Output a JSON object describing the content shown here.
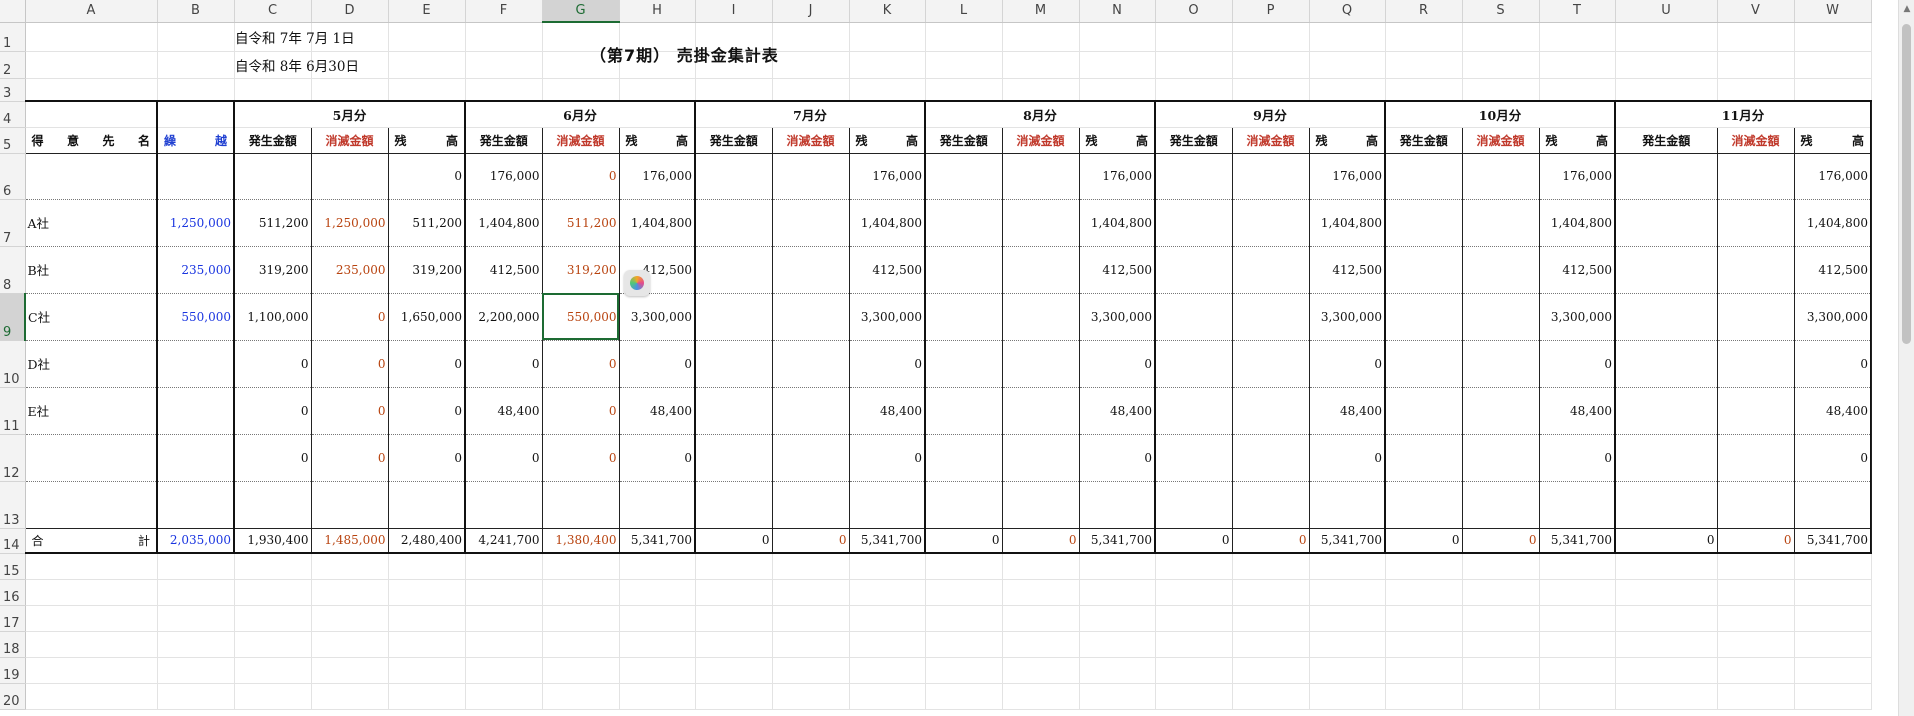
{
  "sheet": {
    "columns": [
      "A",
      "B",
      "C",
      "D",
      "E",
      "F",
      "G",
      "H",
      "I",
      "J",
      "K",
      "L",
      "M",
      "N",
      "O",
      "P",
      "Q",
      "R",
      "S",
      "T",
      "U",
      "V",
      "W"
    ],
    "selected_column": "G",
    "selected_row": 9,
    "row_numbers": [
      "1",
      "2",
      "3",
      "4",
      "5",
      "6",
      "7",
      "8",
      "9",
      "10",
      "11",
      "12",
      "13",
      "14",
      "15",
      "16",
      "17",
      "18",
      "19",
      "20"
    ]
  },
  "header": {
    "date_from": "自令和  7年  7月  1日",
    "date_to": "自令和  8年  6月30日",
    "title": "（第7期）  売掛金集計表"
  },
  "table": {
    "customer_header": "得意先名",
    "carryover_header": "繰越",
    "months": [
      "5月分",
      "6月分",
      "7月分",
      "8月分",
      "9月分",
      "10月分",
      "11月分"
    ],
    "sub_headers": {
      "hassei": "発生金額",
      "shometsu": "消滅金額",
      "zandaka": "残高"
    },
    "rows": [
      {
        "name": "",
        "carry": "",
        "months": [
          [
            "",
            "",
            "0"
          ],
          [
            "176,000",
            "0",
            "176,000"
          ],
          [
            "",
            "",
            "176,000"
          ],
          [
            "",
            "",
            "176,000"
          ],
          [
            "",
            "",
            "176,000"
          ],
          [
            "",
            "",
            "176,000"
          ],
          [
            "",
            "",
            "176,000"
          ]
        ]
      },
      {
        "name": "A社",
        "carry": "1,250,000",
        "months": [
          [
            "511,200",
            "1,250,000",
            "511,200"
          ],
          [
            "1,404,800",
            "511,200",
            "1,404,800"
          ],
          [
            "",
            "",
            "1,404,800"
          ],
          [
            "",
            "",
            "1,404,800"
          ],
          [
            "",
            "",
            "1,404,800"
          ],
          [
            "",
            "",
            "1,404,800"
          ],
          [
            "",
            "",
            "1,404,800"
          ]
        ]
      },
      {
        "name": "B社",
        "carry": "235,000",
        "months": [
          [
            "319,200",
            "235,000",
            "319,200"
          ],
          [
            "412,500",
            "319,200",
            "412,500"
          ],
          [
            "",
            "",
            "412,500"
          ],
          [
            "",
            "",
            "412,500"
          ],
          [
            "",
            "",
            "412,500"
          ],
          [
            "",
            "",
            "412,500"
          ],
          [
            "",
            "",
            "412,500"
          ]
        ]
      },
      {
        "name": "C社",
        "carry": "550,000",
        "months": [
          [
            "1,100,000",
            "0",
            "1,650,000"
          ],
          [
            "2,200,000",
            "550,000",
            "3,300,000"
          ],
          [
            "",
            "",
            "3,300,000"
          ],
          [
            "",
            "",
            "3,300,000"
          ],
          [
            "",
            "",
            "3,300,000"
          ],
          [
            "",
            "",
            "3,300,000"
          ],
          [
            "",
            "",
            "3,300,000"
          ]
        ]
      },
      {
        "name": "D社",
        "carry": "",
        "months": [
          [
            "0",
            "0",
            "0"
          ],
          [
            "0",
            "0",
            "0"
          ],
          [
            "",
            "",
            "0"
          ],
          [
            "",
            "",
            "0"
          ],
          [
            "",
            "",
            "0"
          ],
          [
            "",
            "",
            "0"
          ],
          [
            "",
            "",
            "0"
          ]
        ]
      },
      {
        "name": "E社",
        "carry": "",
        "months": [
          [
            "0",
            "0",
            "0"
          ],
          [
            "48,400",
            "0",
            "48,400"
          ],
          [
            "",
            "",
            "48,400"
          ],
          [
            "",
            "",
            "48,400"
          ],
          [
            "",
            "",
            "48,400"
          ],
          [
            "",
            "",
            "48,400"
          ],
          [
            "",
            "",
            "48,400"
          ]
        ]
      },
      {
        "name": "",
        "carry": "",
        "months": [
          [
            "0",
            "0",
            "0"
          ],
          [
            "0",
            "0",
            "0"
          ],
          [
            "",
            "",
            "0"
          ],
          [
            "",
            "",
            "0"
          ],
          [
            "",
            "",
            "0"
          ],
          [
            "",
            "",
            "0"
          ],
          [
            "",
            "",
            "0"
          ]
        ]
      },
      {
        "name": "",
        "carry": "",
        "months": [
          [
            "",
            "",
            ""
          ],
          [
            "",
            "",
            ""
          ],
          [
            "",
            "",
            ""
          ],
          [
            "",
            "",
            ""
          ],
          [
            "",
            "",
            ""
          ],
          [
            "",
            "",
            ""
          ],
          [
            "",
            "",
            ""
          ]
        ]
      }
    ],
    "total": {
      "label": "合計",
      "carry": "2,035,000",
      "months": [
        [
          "1,930,400",
          "1,485,000",
          "2,480,400"
        ],
        [
          "4,241,700",
          "1,380,400",
          "5,341,700"
        ],
        [
          "0",
          "0",
          "5,341,700"
        ],
        [
          "0",
          "0",
          "5,341,700"
        ],
        [
          "0",
          "0",
          "5,341,700"
        ],
        [
          "0",
          "0",
          "5,341,700"
        ],
        [
          "0",
          "0",
          "5,341,700"
        ]
      ]
    }
  },
  "colors": {
    "negative_red": "#b8430f",
    "carry_blue": "#1a35e0",
    "selection_green": "#1d6b33"
  }
}
